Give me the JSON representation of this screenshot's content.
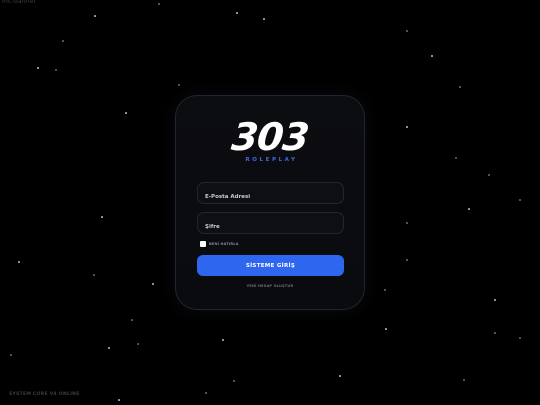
{
  "top_label": "mc-banner",
  "footer_label": "SYSTEM CORE V4 ONLINE",
  "logo": {
    "number": "303",
    "subtitle": "ROLEPLAY"
  },
  "form": {
    "email_placeholder": "E-Posta Adresi",
    "email_value": "",
    "password_placeholder": "Şifre",
    "password_value": "",
    "remember_label": "BENİ HATIRLA",
    "remember_checked": false,
    "submit_label": "SİSTEME GİRİŞ",
    "register_link": "YENİ HESAP OLUŞTUR"
  },
  "colors": {
    "background": "#000000",
    "card": "#0b0c10",
    "accent": "#2f66f0",
    "subtitle": "#3d6be8"
  }
}
